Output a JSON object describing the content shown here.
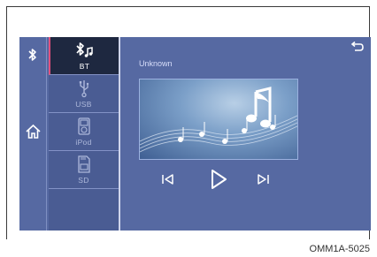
{
  "sidebar": {
    "bluetooth_icon": "bluetooth-icon",
    "home_icon": "home-icon"
  },
  "sources": {
    "items": [
      {
        "label": "BT",
        "icon": "bluetooth-music-icon",
        "active": true
      },
      {
        "label": "USB",
        "icon": "usb-icon",
        "active": false
      },
      {
        "label": "iPod",
        "icon": "ipod-icon",
        "active": false
      },
      {
        "label": "SD",
        "icon": "sd-card-icon",
        "active": false
      }
    ]
  },
  "player": {
    "track_title": "Unknown",
    "back_icon": "back-arrow-icon",
    "album_art": "music-notes-artwork",
    "controls": [
      "previous-track-icon",
      "play-icon",
      "next-track-icon"
    ]
  },
  "figure": {
    "code": "OMM1A-5025"
  },
  "colors": {
    "screen_bg": "#5669a2",
    "active_bg": "#1e2840",
    "active_accent": "#e2507c",
    "icon_white": "#ffffff"
  }
}
